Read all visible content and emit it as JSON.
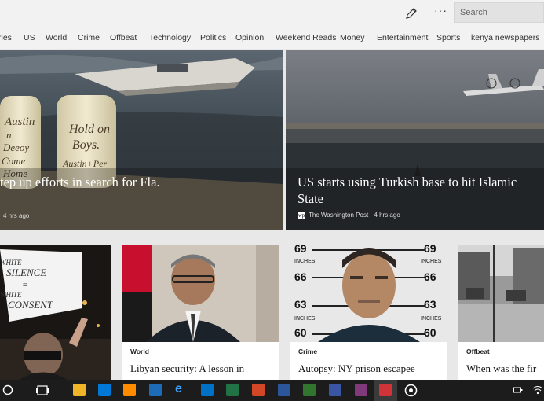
{
  "header": {
    "search_placeholder": "Search",
    "more_label": "···"
  },
  "nav": {
    "items": [
      "ries",
      "US",
      "World",
      "Crime",
      "Offbeat",
      "Technology",
      "Politics",
      "Opinion",
      "Weekend Reads",
      "Money",
      "Entertainment",
      "Sports",
      "kenya newspapers"
    ]
  },
  "hero": [
    {
      "title": "tep up efforts in search for Fla.",
      "source": "",
      "time": "4 hrs ago"
    },
    {
      "title_line1": "US starts using Turkish base to hit Islamic",
      "title_line2": "State",
      "source_logo": "wp",
      "source": "The Washington Post",
      "time": "4 hrs ago"
    }
  ],
  "cards": [
    {
      "category": "",
      "title": "",
      "sign_text": [
        "WHITE",
        "SILENCE",
        "=",
        "WHITE",
        "CONSENT"
      ]
    },
    {
      "category": "World",
      "title": "Libyan security: A lesson in"
    },
    {
      "category": "Crime",
      "title": "Autopsy: NY prison escapee",
      "mugshot_marks": [
        "69",
        "69",
        "INCHES",
        "INCHES",
        "66",
        "66",
        "63",
        "63",
        "INCHES",
        "INCHES",
        "60",
        "60"
      ]
    },
    {
      "category": "Offbeat",
      "title": "When was the fir"
    }
  ],
  "taskbar": {
    "icons": [
      "cortana-icon",
      "task-view-icon",
      "file-explorer-icon",
      "store-icon",
      "photos-icon",
      "desktop-icon",
      "edge-icon",
      "outlook-icon",
      "excel-icon",
      "powerpoint-icon",
      "word-icon",
      "project-icon",
      "visio-icon",
      "onenote-icon",
      "news-icon",
      "groove-icon"
    ],
    "colors": {
      "explorer": "#f0b429",
      "store": "#0078d7",
      "photos": "#ff8c00",
      "edge": "#1e88e5",
      "outlook": "#0072c6",
      "excel": "#217346",
      "powerpoint": "#d24726",
      "word": "#2b579a",
      "project": "#31752f",
      "visio": "#3955a3",
      "onenote": "#80397b",
      "news": "#d13438"
    }
  }
}
